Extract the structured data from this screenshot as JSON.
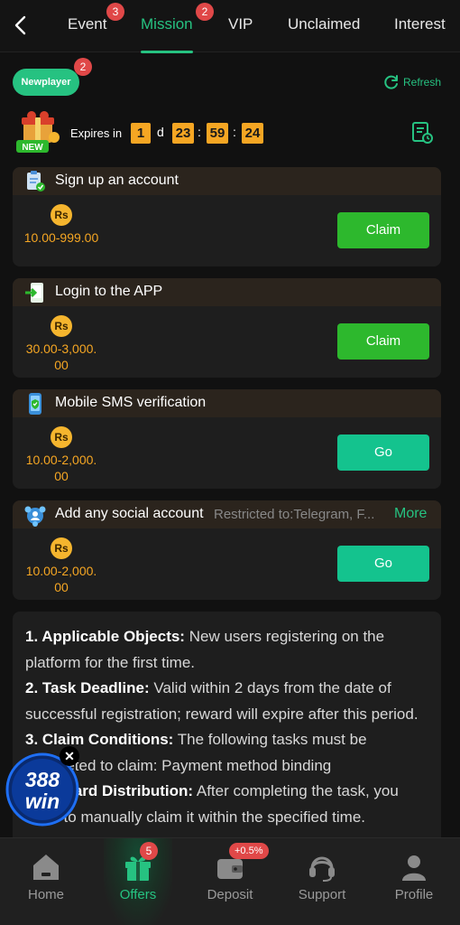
{
  "tabs": [
    {
      "label": "Event",
      "badge": "3"
    },
    {
      "label": "Mission",
      "badge": "2",
      "active": true
    },
    {
      "label": "VIP"
    },
    {
      "label": "Unclaimed"
    },
    {
      "label": "Interest"
    }
  ],
  "filter": {
    "newplayer_label": "Newplayer",
    "newplayer_badge": "2",
    "refresh_label": "Refresh"
  },
  "expires": {
    "label": "Expires in",
    "days": "1",
    "days_unit": "d",
    "hours": "23",
    "minutes": "59",
    "seconds": "24",
    "gift_tag": "NEW"
  },
  "tasks": [
    {
      "title": "Sign up an account",
      "currency": "Rs",
      "amount": "10.00-999.00",
      "button": "Claim",
      "icon": "clipboard-check-icon"
    },
    {
      "title": "Login to the APP",
      "currency": "Rs",
      "amount": "30.00-3,000.00",
      "button": "Claim",
      "icon": "login-app-icon"
    },
    {
      "title": "Mobile SMS verification",
      "currency": "Rs",
      "amount": "10.00-2,000.00",
      "button": "Go",
      "icon": "phone-verify-icon"
    },
    {
      "title": "Add any social account",
      "restricted": "Restricted to:Telegram, F...",
      "more": "More",
      "currency": "Rs",
      "amount": "10.00-2,000.00",
      "button": "Go",
      "icon": "social-account-icon"
    }
  ],
  "rules": [
    {
      "bold": "1. Applicable Objects:",
      "text": " New users registering on the platform for the first time."
    },
    {
      "bold": "2. Task Deadline:",
      "text": " Valid within 2 days from the date of successful registration; reward will expire after this period."
    },
    {
      "bold": "3. Claim Conditions:",
      "text": " The following tasks must be completed to claim: Payment method binding"
    },
    {
      "bold": "4. Reward Distribution:",
      "text": " After completing the task, you need to manually claim it within the specified time."
    }
  ],
  "logo": {
    "text_top": "388",
    "text_bottom": "win",
    "close": "✕"
  },
  "nav": [
    {
      "label": "Home",
      "icon": "home-icon"
    },
    {
      "label": "Offers",
      "icon": "gift-icon",
      "badge": "5",
      "active": true
    },
    {
      "label": "Deposit",
      "icon": "wallet-icon",
      "tag": "+0.5%"
    },
    {
      "label": "Support",
      "icon": "headset-icon"
    },
    {
      "label": "Profile",
      "icon": "user-icon"
    }
  ],
  "colors": {
    "accent": "#26c281",
    "amount": "#f5a623",
    "claim": "#2db82d",
    "go": "#14c38e",
    "badge": "#e04848"
  }
}
